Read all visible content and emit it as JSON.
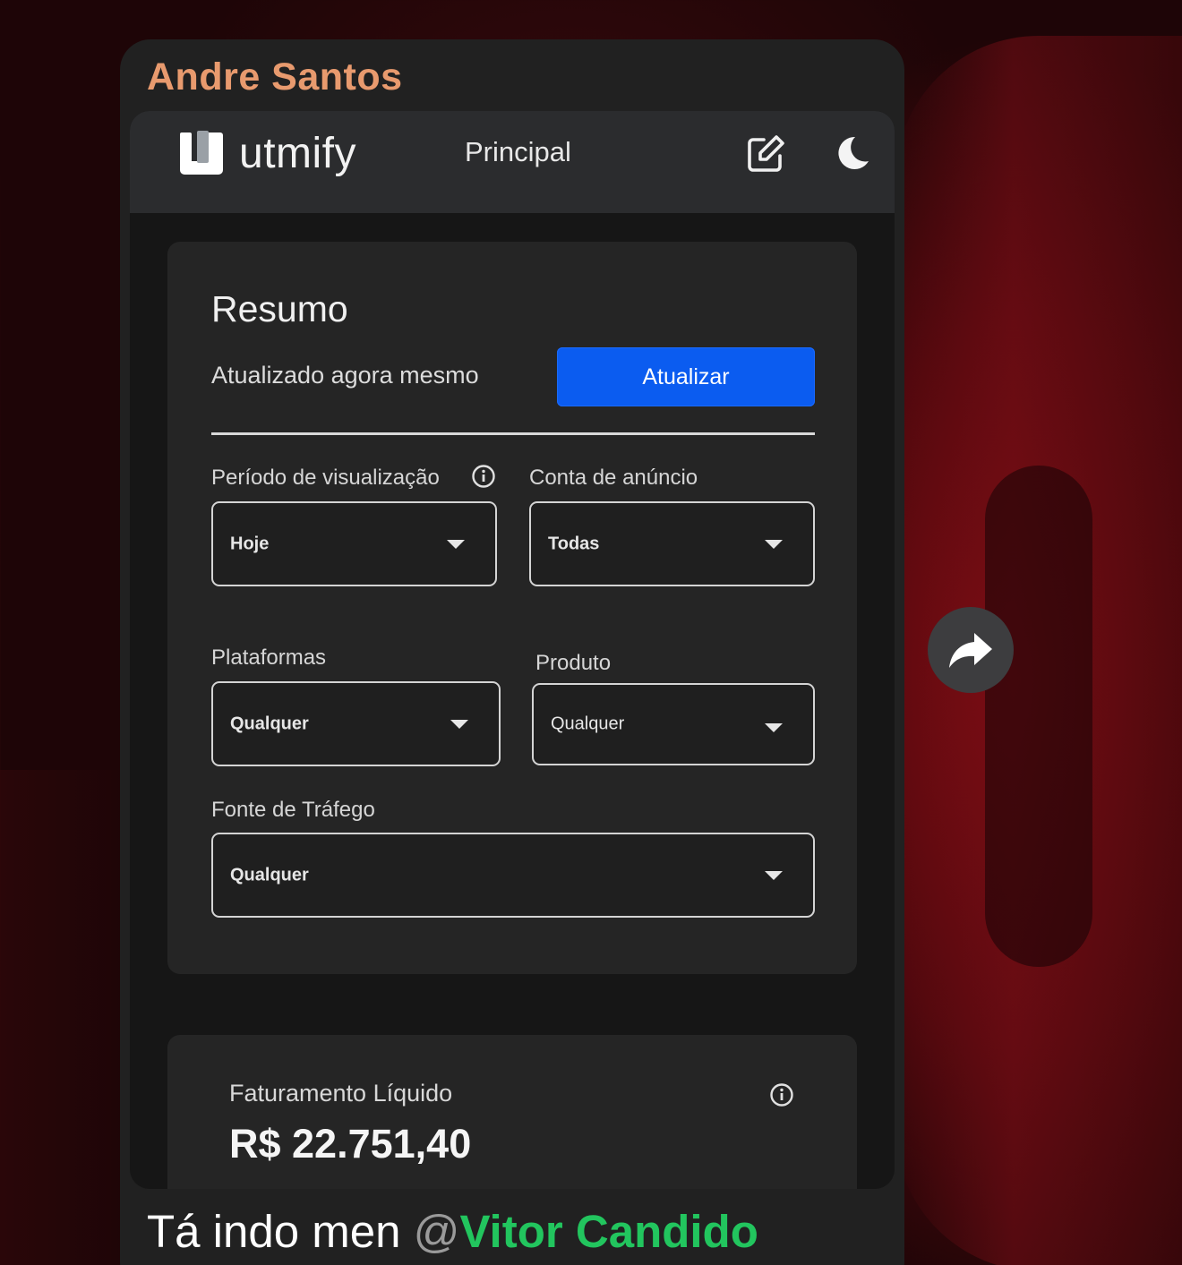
{
  "message": {
    "sender": "Andre Santos",
    "caption_text": "Tá indo men ",
    "mention_at": "@",
    "mention_name": "Vitor Candido"
  },
  "app": {
    "logo_text": "utmify",
    "nav_title": "Principal",
    "icons": {
      "edit": "edit-icon",
      "theme": "moon-icon",
      "share": "forward-arrow-icon",
      "info": "info-icon"
    }
  },
  "resumo": {
    "title": "Resumo",
    "updated_text": "Atualizado agora mesmo",
    "refresh_button": "Atualizar",
    "button_color": "#0b5cf0",
    "filters": {
      "periodo": {
        "label": "Período de visualização",
        "value": "Hoje"
      },
      "conta": {
        "label": "Conta de anúncio",
        "value": "Todas"
      },
      "plataformas": {
        "label": "Plataformas",
        "value": "Qualquer"
      },
      "produto": {
        "label": "Produto",
        "value": "Qualquer"
      },
      "fonte": {
        "label": "Fonte de Tráfego",
        "value": "Qualquer"
      }
    }
  },
  "metric": {
    "label": "Faturamento Líquido",
    "value": "R$ 22.751,40"
  },
  "colors": {
    "sender": "#e89a6e",
    "mention": "#22c55e"
  }
}
